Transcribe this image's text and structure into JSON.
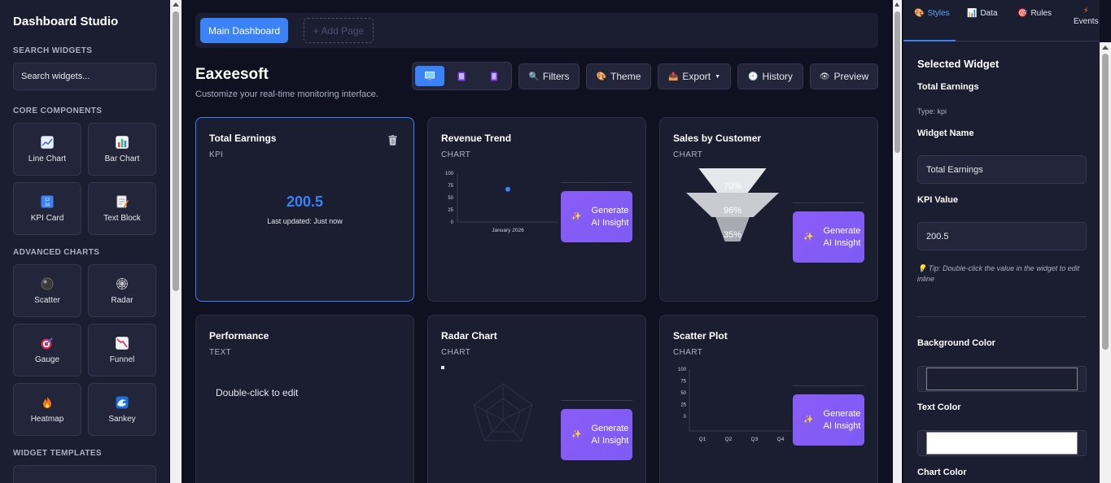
{
  "sidebar": {
    "brand": "Dashboard Studio",
    "search_title": "SEARCH WIDGETS",
    "search_placeholder": "Search widgets...",
    "core_title": "CORE COMPONENTS",
    "core": [
      {
        "label": "Line Chart",
        "icon": "line-chart-icon",
        "color": "#9fb8d8"
      },
      {
        "label": "Bar Chart",
        "icon": "bar-chart-icon",
        "color": "#f59e0b"
      },
      {
        "label": "KPI Card",
        "icon": "kpi-numbers-icon",
        "color": "#3b82f6"
      },
      {
        "label": "Text Block",
        "icon": "memo-icon",
        "color": "#fbbf24"
      }
    ],
    "advanced_title": "ADVANCED CHARTS",
    "advanced": [
      {
        "label": "Scatter",
        "icon": "scatter-ball-icon",
        "color": "#555555"
      },
      {
        "label": "Radar",
        "icon": "radar-web-icon",
        "color": "#cccccc"
      },
      {
        "label": "Gauge",
        "icon": "target-icon",
        "color": "#e11d48"
      },
      {
        "label": "Funnel",
        "icon": "funnel-chart-icon",
        "color": "#f87171"
      },
      {
        "label": "Heatmap",
        "icon": "fire-icon",
        "color": "#f97316"
      },
      {
        "label": "Sankey",
        "icon": "wave-icon",
        "color": "#38bdf8"
      }
    ],
    "templates_title": "WIDGET TEMPLATES"
  },
  "main": {
    "page_tab": "Main Dashboard",
    "add_page": "+ Add Page",
    "title": "Eaxeesoft",
    "subtitle": "Customize your real-time monitoring interface.",
    "toolbar": {
      "filters": "Filters",
      "theme": "Theme",
      "export": "Export",
      "history": "History",
      "preview": "Preview"
    },
    "ai_button": "Generate AI Insight",
    "cards": {
      "total_earnings": {
        "title": "Total Earnings",
        "type": "KPI",
        "value": "200.5",
        "updated": "Last updated: Just now"
      },
      "revenue": {
        "title": "Revenue Trend",
        "type": "CHART"
      },
      "sales": {
        "title": "Sales by Customer",
        "type": "CHART"
      },
      "performance": {
        "title": "Performance",
        "type": "TEXT",
        "body": "Double-click to edit"
      },
      "radar": {
        "title": "Radar Chart",
        "type": "CHART"
      },
      "scatter": {
        "title": "Scatter Plot",
        "type": "CHART"
      }
    }
  },
  "panel": {
    "tabs": [
      {
        "label": "Styles",
        "icon": "palette-icon"
      },
      {
        "label": "Data",
        "icon": "bar-chart-icon"
      },
      {
        "label": "Rules",
        "icon": "target-icon"
      },
      {
        "label": "Events",
        "icon": "lightning-icon"
      }
    ],
    "heading": "Selected Widget",
    "widget_title": "Total Earnings",
    "widget_type": "Type: kpi",
    "name_label": "Widget Name",
    "name_value": "Total Earnings",
    "kpi_label": "KPI Value",
    "kpi_value": "200.5",
    "tip": "💡 Tip: Double-click the value in the widget to edit inline",
    "bg_label": "Background Color",
    "text_label": "Text Color",
    "chart_label": "Chart Color",
    "bg_color": "#1b1d30",
    "text_color": "#ffffff"
  },
  "chart_data": [
    {
      "type": "line",
      "y_ticks": [
        "100",
        "75",
        "50",
        "25",
        "0"
      ],
      "ylim": [
        0,
        100
      ],
      "x": [
        "January 2026"
      ],
      "values": [
        67
      ]
    },
    {
      "type": "funnel",
      "labels": [
        "70%",
        "96%",
        "35%"
      ],
      "values": [
        70,
        96,
        35
      ]
    },
    {
      "type": "scatter",
      "y_ticks": [
        "100",
        "75",
        "50",
        "25",
        "0"
      ],
      "ylim": [
        0,
        100
      ],
      "categories": [
        "Q1",
        "Q2",
        "Q3",
        "Q4"
      ]
    }
  ]
}
